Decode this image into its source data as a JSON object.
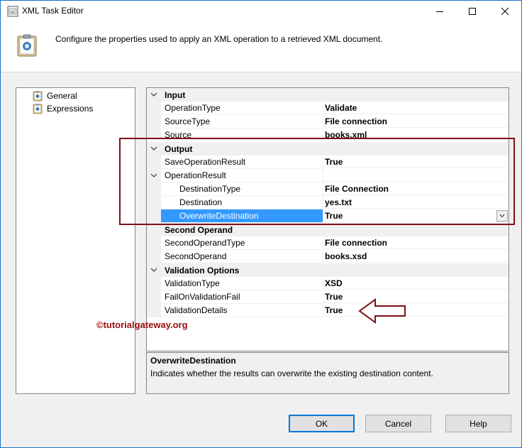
{
  "window": {
    "title": "XML Task Editor"
  },
  "header": {
    "description": "Configure the properties used to apply an XML operation to a retrieved XML document."
  },
  "nav": {
    "items": [
      {
        "label": "General"
      },
      {
        "label": "Expressions"
      }
    ]
  },
  "grid": {
    "categories": {
      "input": "Input",
      "output": "Output",
      "second_operand": "Second Operand",
      "validation": "Validation Options"
    },
    "properties": {
      "operation_type": {
        "name": "OperationType",
        "value": "Validate"
      },
      "source_type": {
        "name": "SourceType",
        "value": "File connection"
      },
      "source": {
        "name": "Source",
        "value": "books.xml"
      },
      "save_operation_result": {
        "name": "SaveOperationResult",
        "value": "True"
      },
      "operation_result": {
        "name": "OperationResult",
        "value": ""
      },
      "destination_type": {
        "name": "DestinationType",
        "value": "File Connection"
      },
      "destination": {
        "name": "Destination",
        "value": "yes.txt"
      },
      "overwrite_destination": {
        "name": "OverwriteDestination",
        "value": "True"
      },
      "second_operand_type": {
        "name": "SecondOperandType",
        "value": "File connection"
      },
      "second_operand": {
        "name": "SecondOperand",
        "value": "books.xsd"
      },
      "validation_type": {
        "name": "ValidationType",
        "value": "XSD"
      },
      "fail_on_validation_fail": {
        "name": "FailOnValidationFail",
        "value": "True"
      },
      "validation_details": {
        "name": "ValidationDetails",
        "value": "True"
      }
    }
  },
  "description_panel": {
    "title": "OverwriteDestination",
    "text": "Indicates whether the results can overwrite the existing destination content."
  },
  "watermark": "©tutorialgateway.org",
  "buttons": {
    "ok": "OK",
    "cancel": "Cancel",
    "help": "Help"
  },
  "colors": {
    "selection": "#3399ff",
    "highlight": "#7b1219",
    "default_button_border": "#0078d7"
  }
}
